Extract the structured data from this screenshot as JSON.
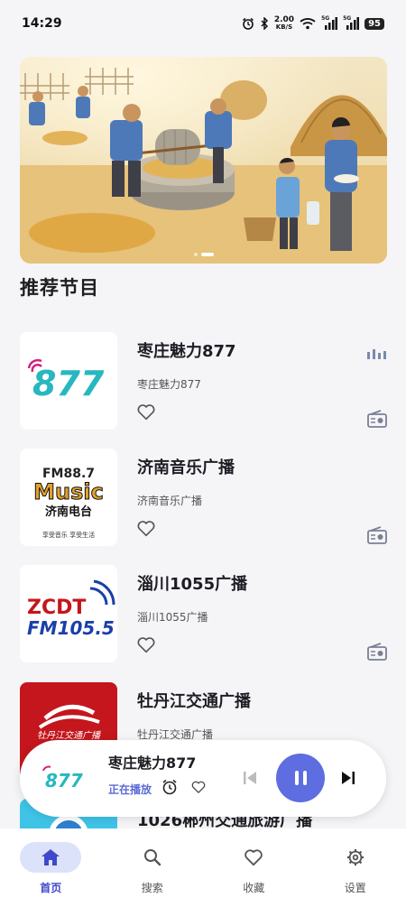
{
  "status_bar": {
    "time": "14:29",
    "net_speed_value": "2.00",
    "net_speed_unit": "KB/S",
    "signal_1": "5G",
    "signal_2": "5G",
    "battery": "95",
    "icons": [
      "alarm-icon",
      "bluetooth-icon",
      "wifi-icon",
      "signal-icon",
      "signal-icon",
      "battery-icon"
    ]
  },
  "banner": {
    "slide_count": 2,
    "active_slide": 1
  },
  "section_title": "推荐节目",
  "programs": [
    {
      "title": "枣庄魅力877",
      "subtitle": "枣庄魅力877",
      "logo_text": "877",
      "playing": true
    },
    {
      "title": "济南音乐广播",
      "subtitle": "济南音乐广播",
      "logo_top": "FM88.7",
      "logo_main": "Music",
      "logo_cn": "济南电台",
      "logo_slogan": "享受音乐  享受生活"
    },
    {
      "title": "淄川1055广播",
      "subtitle": "淄川1055广播",
      "logo_top": "ZCDT",
      "logo_bottom": "FM105.5"
    },
    {
      "title": "牡丹江交通广播",
      "subtitle": "牡丹江交通广播",
      "logo_cn": "牡丹江交通广播"
    },
    {
      "title": "1026郴州交通旅游广播"
    }
  ],
  "player": {
    "title": "枣庄魅力877",
    "state": "正在播放",
    "logo_text": "877"
  },
  "nav": [
    {
      "label": "首页",
      "icon": "home-icon",
      "active": true
    },
    {
      "label": "搜索",
      "icon": "search-icon"
    },
    {
      "label": "收藏",
      "icon": "heart-icon"
    },
    {
      "label": "设置",
      "icon": "gear-icon"
    }
  ],
  "colors": {
    "accent": "#5e6de0",
    "teal": "#27b7bf",
    "magenta": "#d1217a",
    "red_brand": "#c4161c",
    "blue_brand": "#1a3fa8"
  }
}
